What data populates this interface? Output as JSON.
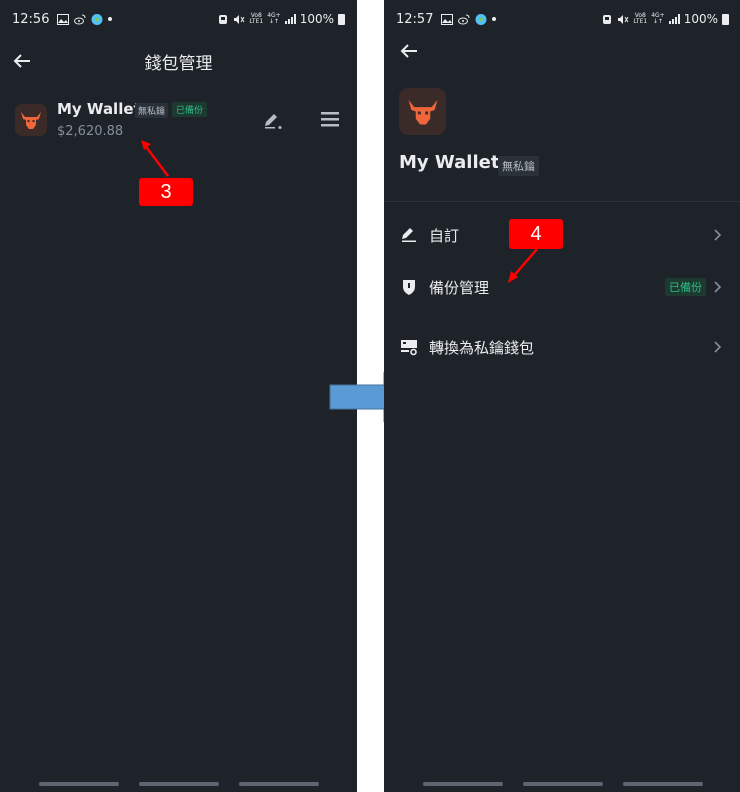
{
  "left_screen": {
    "status": {
      "time": "12:56",
      "battery": "100%",
      "net_top": "Vo8",
      "net_bottom": "LTE1",
      "net4g_top": "4G+",
      "net4g_bottom": "↓↑"
    },
    "title": "錢包管理",
    "wallet": {
      "name": "My Wallet",
      "tag_no_key": "無私鑰",
      "tag_backup": "已備份",
      "balance": "$2,620.88"
    },
    "callout": "3"
  },
  "right_screen": {
    "status": {
      "time": "12:57",
      "battery": "100%",
      "net_top": "Vo8",
      "net_bottom": "LTE1",
      "net4g_top": "4G+",
      "net4g_bottom": "↓↑"
    },
    "wallet": {
      "name": "My Wallet",
      "tag_no_key": "無私鑰"
    },
    "menu": [
      {
        "label": "自訂",
        "icon": "pencil-icon",
        "tag": ""
      },
      {
        "label": "備份管理",
        "icon": "shield-icon",
        "tag": "已備份"
      },
      {
        "label": "轉換為私鑰錢包",
        "icon": "key-transfer-icon",
        "tag": ""
      }
    ],
    "callout": "4"
  },
  "colors": {
    "background": "#1e2329",
    "accent_orange": "#f0663b",
    "backup_green": "#2ebd85",
    "callout_red": "#ff0000",
    "arrow_blue": "#5b9bd5"
  }
}
